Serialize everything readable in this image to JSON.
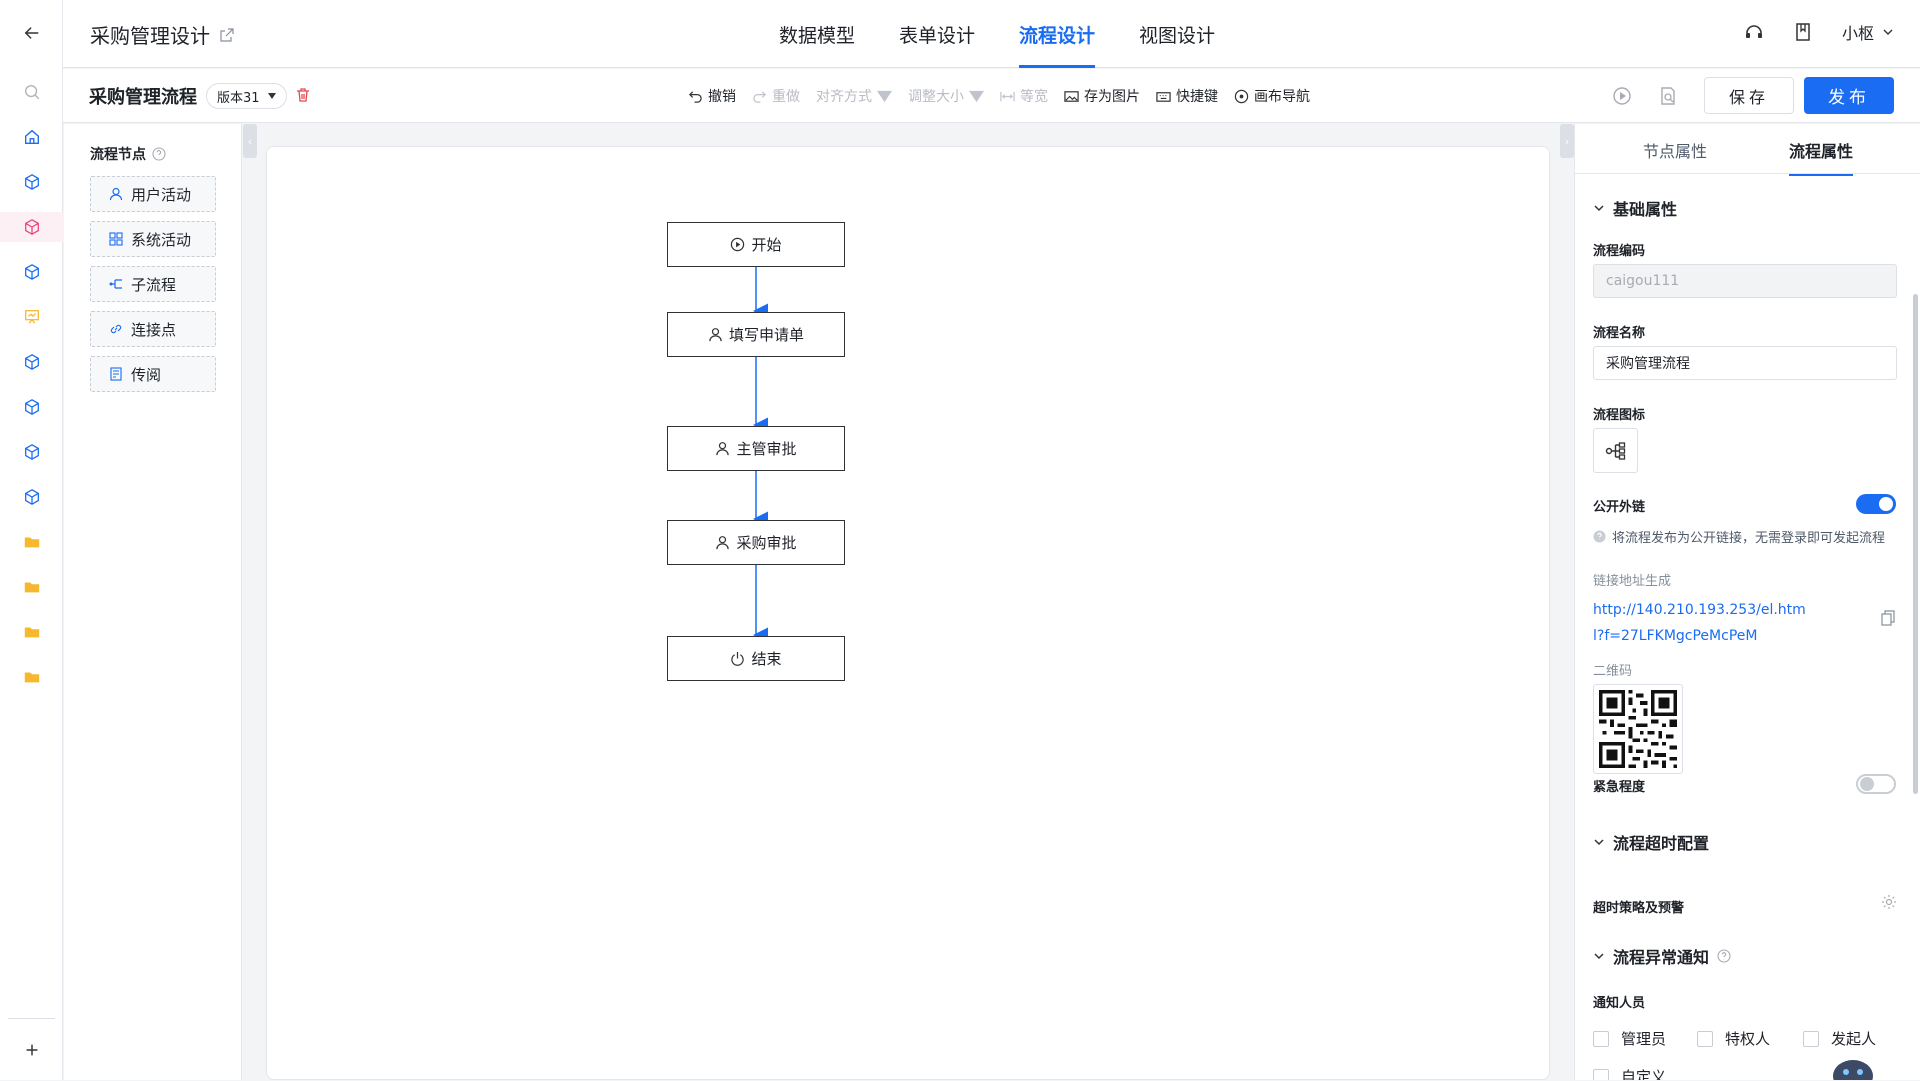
{
  "app": {
    "title": "采购管理设计"
  },
  "tabs": [
    {
      "label": "数据模型"
    },
    {
      "label": "表单设计"
    },
    {
      "label": "流程设计",
      "active": true
    },
    {
      "label": "视图设计"
    }
  ],
  "user": {
    "name": "小枢"
  },
  "process": {
    "title": "采购管理流程",
    "version": "版本31"
  },
  "toolbar": {
    "undo": "撤销",
    "redo": "重做",
    "align": "对齐方式",
    "resize": "调整大小",
    "equal_width": "等宽",
    "save_image": "存为图片",
    "shortcuts": "快捷键",
    "canvas_nav": "画布导航"
  },
  "buttons": {
    "save": "保存",
    "publish": "发布"
  },
  "node_panel": {
    "title": "流程节点",
    "items": [
      {
        "label": "用户活动",
        "icon": "user-icon"
      },
      {
        "label": "系统活动",
        "icon": "grid-icon"
      },
      {
        "label": "子流程",
        "icon": "subflow-icon"
      },
      {
        "label": "连接点",
        "icon": "link-icon"
      },
      {
        "label": "传阅",
        "icon": "document-icon"
      }
    ]
  },
  "flow": {
    "nodes": [
      {
        "label": "开始",
        "icon": "play-circle-icon"
      },
      {
        "label": "填写申请单",
        "icon": "user-icon"
      },
      {
        "label": "主管审批",
        "icon": "user-icon"
      },
      {
        "label": "采购审批",
        "icon": "user-icon"
      },
      {
        "label": "结束",
        "icon": "power-icon"
      }
    ]
  },
  "right_panel": {
    "tabs": [
      "节点属性",
      "流程属性"
    ],
    "active_tab": "流程属性",
    "basic": {
      "section": "基础属性",
      "code_label": "流程编码",
      "code_value": "caigou111",
      "name_label": "流程名称",
      "name_value": "采购管理流程",
      "icon_label": "流程图标",
      "public_label": "公开外链",
      "public_on": true,
      "public_hint": "将流程发布为公开链接，无需登录即可发起流程",
      "link_label": "链接地址生成",
      "link_value": "http://140.210.193.253/el.html?f=27LFKMgcPeMcPeM",
      "qr_label": "二维码",
      "urgency_label": "紧急程度",
      "urgency_on": false
    },
    "timeout": {
      "section": "流程超时配置",
      "policy_label": "超时策略及预警"
    },
    "exception": {
      "section": "流程异常通知",
      "notify_label": "通知人员",
      "options": [
        "管理员",
        "特权人",
        "发起人",
        "自定义"
      ]
    }
  },
  "colors": {
    "accent": "#1a6cf2",
    "folder": "#f5b82e",
    "cube_active": "#e8457c"
  }
}
